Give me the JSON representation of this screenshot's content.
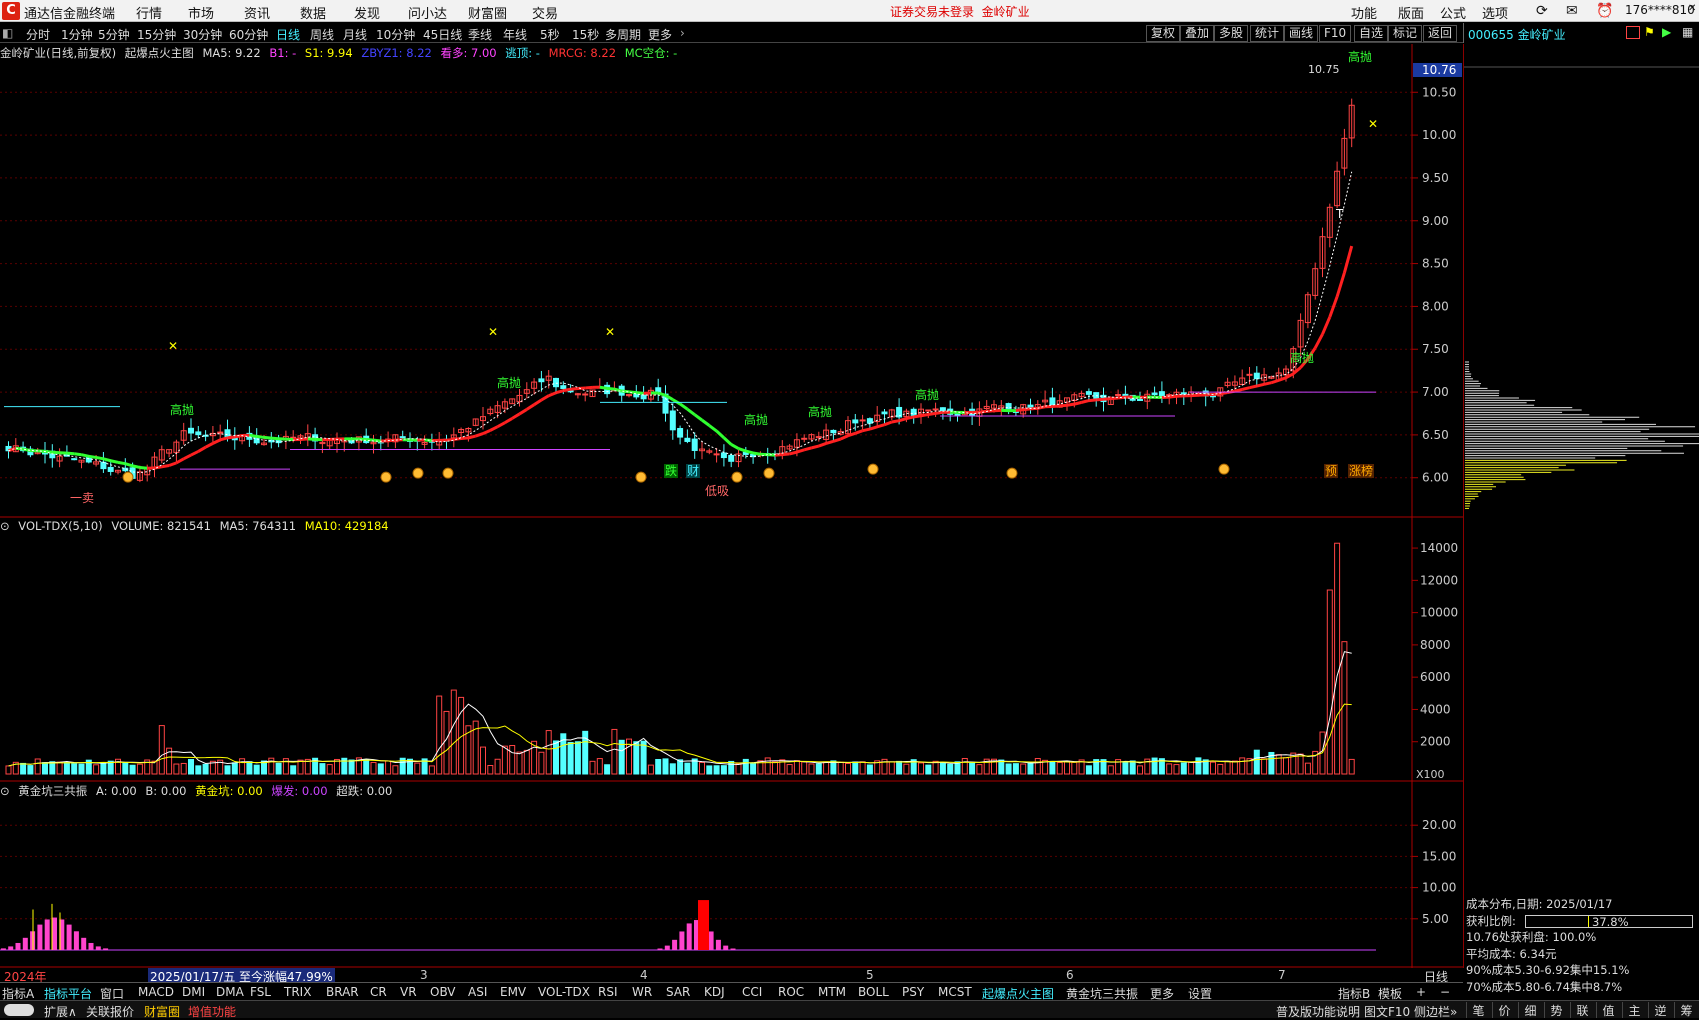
{
  "app": {
    "title": "通达信金融终端",
    "logo_letter": "C"
  },
  "menu": [
    "行情",
    "市场",
    "资讯",
    "数据",
    "发现",
    "问小达",
    "财富圈",
    "交易"
  ],
  "warning": {
    "text": "证券交易未登录",
    "stock": "金岭矿业"
  },
  "right_menu": [
    "功能",
    "版面",
    "公式",
    "选项"
  ],
  "user": "176****810",
  "periods": [
    "分时",
    "1分钟",
    "5分钟",
    "15分钟",
    "30分钟",
    "60分钟",
    "日线",
    "周线",
    "月线",
    "10分钟",
    "45日线",
    "季线",
    "年线",
    "5秒",
    "15秒",
    "多周期",
    "更多"
  ],
  "active_period": "日线",
  "toolbar": [
    "复权",
    "叠加",
    "多股",
    "统计",
    "画线",
    "F10",
    "自选",
    "标记",
    "返回"
  ],
  "panel_code": "000655 金岭矿业",
  "main_legend": {
    "stock": "金岭矿业(日线,前复权)",
    "formula": "起爆点火主图",
    "ma5": "MA5: 9.22",
    "b1": "B1: -",
    "s1": "S1: 9.94",
    "zbyz": "ZBYZ1: 8.22",
    "kanduo": "看多: 7.00",
    "taoding": "逃顶: -",
    "mrcg": "MRCG: 8.22",
    "mc": "MC空仓: -"
  },
  "main_axis": {
    "labels": [
      "10.50",
      "10.00",
      "9.50",
      "9.00",
      "8.50",
      "8.00",
      "7.50",
      "7.00",
      "6.50",
      "6.00"
    ],
    "current": "10.76",
    "high_label": "10.75"
  },
  "annotations": {
    "high_sell": "高抛",
    "low_buy": "低吸",
    "one_sell": "一卖",
    "T": "T",
    "die": "跌",
    "cai": "财",
    "yu": "预",
    "zhangting": "涨榜"
  },
  "vol_legend": {
    "name": "VOL-TDX(5,10)",
    "volume": "VOLUME: 821541",
    "ma5": "MA5: 764311",
    "ma10": "MA10: 429184"
  },
  "vol_axis": {
    "labels": [
      "14000",
      "12000",
      "10000",
      "8000",
      "6000",
      "4000",
      "2000"
    ],
    "unit": "X100"
  },
  "ind_legend": {
    "name": "黄金坑三共振",
    "a": "A: 0.00",
    "b": "B: 0.00",
    "hjk": "黄金坑: 0.00",
    "baofa": "爆发: 0.00",
    "chaodie": "超跌: 0.00"
  },
  "ind_axis": {
    "labels": [
      "20.00",
      "15.00",
      "10.00",
      "5.00"
    ]
  },
  "x_axis": {
    "labels": [
      "2024年",
      "3",
      "4",
      "5",
      "6",
      "7"
    ],
    "right": "日线",
    "highlight": "2025/01/17/五 至今涨幅47.99%"
  },
  "bottom_tabs": [
    "指标A",
    "指标平台",
    "窗口",
    "MACD",
    "DMI",
    "DMA",
    "FSL",
    "TRIX",
    "BRAR",
    "CR",
    "VR",
    "OBV",
    "ASI",
    "EMV",
    "VOL-TDX",
    "RSI",
    "WR",
    "SAR",
    "KDJ",
    "CCI",
    "ROC",
    "MTM",
    "BOLL",
    "PSY",
    "MCST",
    "起爆点火主图",
    "黄金坑三共振",
    "更多",
    "设置"
  ],
  "bottom_right": [
    "指标B",
    "模板",
    "+",
    "−"
  ],
  "status_left": [
    "扩展∧",
    "关联报价",
    "财富圈",
    "增值功能"
  ],
  "status_right": [
    "普及版功能说明",
    "图文F10",
    "侧边栏»"
  ],
  "right_status_tabs": [
    "笔",
    "价",
    "细",
    "势",
    "联",
    "值",
    "主",
    "逆",
    "筹"
  ],
  "cost_dist": {
    "title": "成本分布,日期: 2025/01/17",
    "profit_label": "获利比例:",
    "profit_value": "37.8%",
    "profit_ratio": 0.378,
    "line2": "10.76处获利盘: 100.0%",
    "line3": "平均成本: 6.34元",
    "line4": "90%成本5.30-6.92集中15.1%",
    "line5": "70%成本5.80-6.74集中8.7%"
  },
  "colors": {
    "up": "#ff4444",
    "down": "#54ffff",
    "ma_red": "#ff2020",
    "ma_green": "#30ff30",
    "accent": "#54ffff"
  }
}
